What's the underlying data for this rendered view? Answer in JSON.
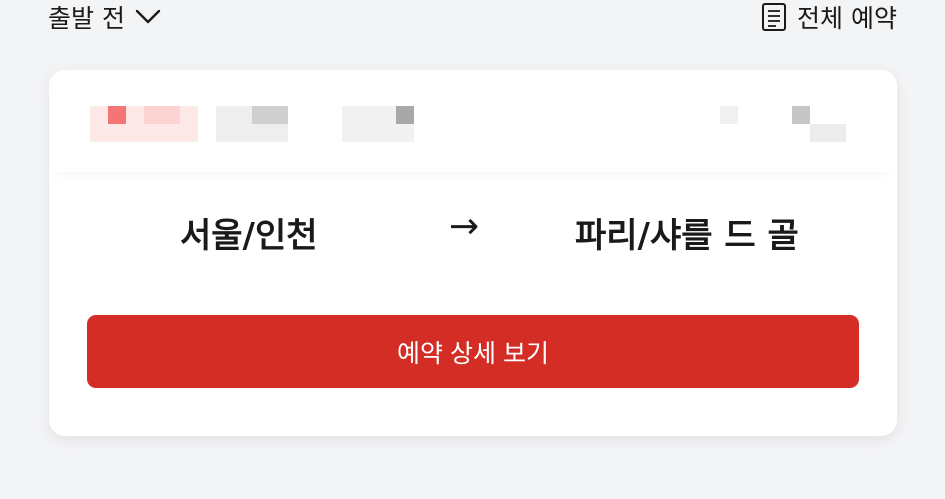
{
  "header": {
    "filter_label": "출발 전",
    "filter_icon": "chevron-down-icon",
    "all_reservations_label": "전체 예약",
    "all_reservations_icon": "document-list-icon"
  },
  "card": {
    "origin": "서울/인천",
    "arrow": "→",
    "destination": "파리/샤를 드 골",
    "detail_button_label": "예약 상세 보기"
  },
  "colors": {
    "accent": "#d32d26",
    "background": "#f3f4f6",
    "card": "#ffffff"
  }
}
